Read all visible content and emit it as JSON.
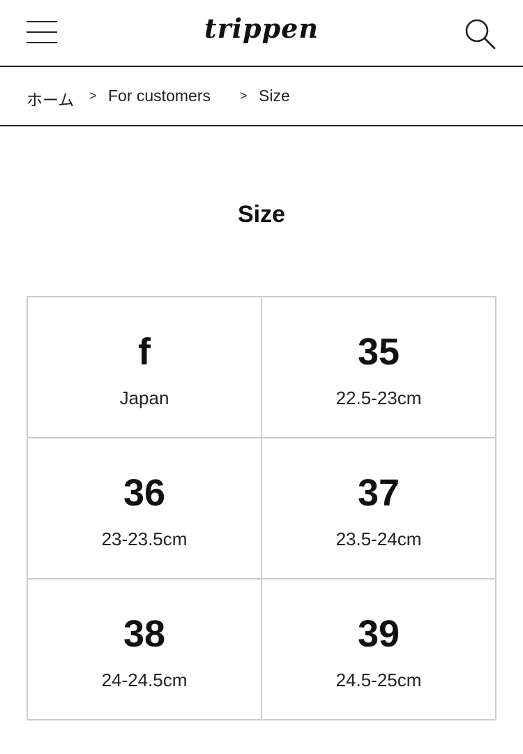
{
  "header": {
    "menu_icon": "hamburger-menu-icon",
    "logo": "trippen",
    "search_icon": "magnifier-search-icon"
  },
  "breadcrumb": {
    "items": [
      "ホーム",
      "For customers",
      "Size"
    ],
    "separator": ">"
  },
  "page": {
    "title": "Size"
  },
  "size_table": [
    {
      "size": "f",
      "range": "Japan"
    },
    {
      "size": "35",
      "range": "22.5-23cm"
    },
    {
      "size": "36",
      "range": "23-23.5cm"
    },
    {
      "size": "37",
      "range": "23.5-24cm"
    },
    {
      "size": "38",
      "range": "24-24.5cm"
    },
    {
      "size": "39",
      "range": "24.5-25cm"
    }
  ],
  "colors": {
    "text": "#111111",
    "rule": "#222222",
    "grid_border": "#cccccc",
    "background": "#ffffff"
  }
}
